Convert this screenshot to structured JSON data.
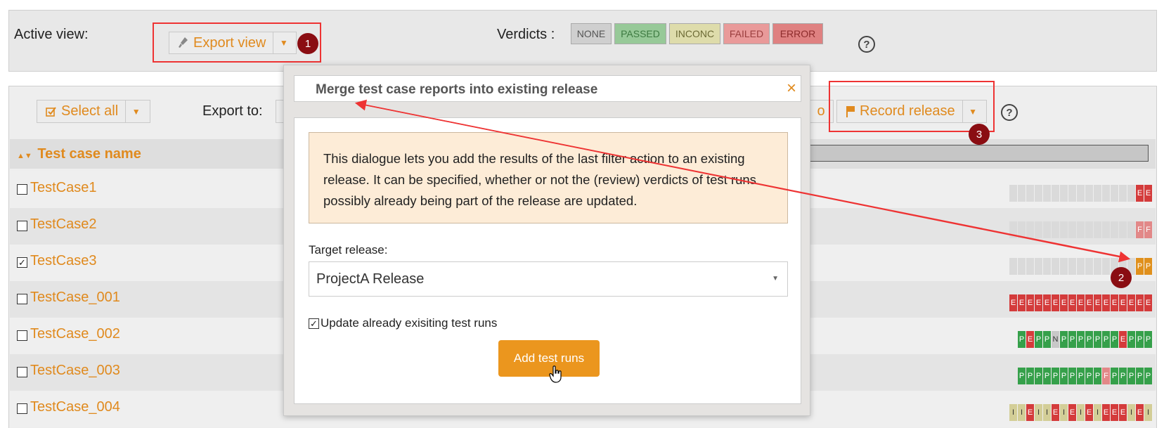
{
  "top": {
    "active_view_label": "Active view:",
    "export_view_label": "Export view",
    "verdicts_label": "Verdicts :",
    "verdicts": [
      {
        "label": "NONE",
        "bg": "#cfcfcf",
        "fg": "#555555"
      },
      {
        "label": "PASSED",
        "bg": "#97c998",
        "fg": "#3d7a41"
      },
      {
        "label": "INCONC",
        "bg": "#dedcab",
        "fg": "#6c6a35"
      },
      {
        "label": "FAILED",
        "bg": "#e99a9a",
        "fg": "#9b3f3f"
      },
      {
        "label": "ERROR",
        "bg": "#df8181",
        "fg": "#8d2c2c"
      }
    ],
    "help_glyph": "?"
  },
  "toolbar": {
    "select_all_label": "Select all",
    "export_to_label": "Export to:",
    "hidden_fragment": "o",
    "record_release_label": "Record release",
    "help_glyph": "?"
  },
  "table": {
    "column_header": "Test case name",
    "rows": [
      {
        "name": "TestCase1",
        "checked": false,
        "runs": [
          "",
          "",
          "",
          "",
          "",
          "",
          "",
          "",
          "",
          "",
          "",
          "",
          "",
          "",
          "",
          "E",
          "E"
        ],
        "kind": [
          "empty",
          "empty",
          "empty",
          "empty",
          "empty",
          "empty",
          "empty",
          "empty",
          "empty",
          "empty",
          "empty",
          "empty",
          "empty",
          "empty",
          "empty",
          "E",
          "E"
        ]
      },
      {
        "name": "TestCase2",
        "checked": false,
        "runs": [
          "",
          "",
          "",
          "",
          "",
          "",
          "",
          "",
          "",
          "",
          "",
          "",
          "",
          "",
          "",
          "F",
          "F"
        ],
        "kind": [
          "empty",
          "empty",
          "empty",
          "empty",
          "empty",
          "empty",
          "empty",
          "empty",
          "empty",
          "empty",
          "empty",
          "empty",
          "empty",
          "empty",
          "empty",
          "F",
          "F"
        ]
      },
      {
        "name": "TestCase3",
        "checked": true,
        "runs": [
          "",
          "",
          "",
          "",
          "",
          "",
          "",
          "",
          "",
          "",
          "",
          "",
          "",
          "",
          "",
          "P",
          "P"
        ],
        "kind": [
          "empty",
          "empty",
          "empty",
          "empty",
          "empty",
          "empty",
          "empty",
          "empty",
          "empty",
          "empty",
          "empty",
          "empty",
          "empty",
          "empty",
          "empty",
          "P",
          "P"
        ]
      },
      {
        "name": "TestCase_001",
        "checked": false,
        "runs": [
          "E",
          "E",
          "E",
          "E",
          "E",
          "E",
          "E",
          "E",
          "E",
          "E",
          "E",
          "E",
          "E",
          "E",
          "E",
          "E",
          "E"
        ],
        "kind": [
          "E",
          "E",
          "E",
          "E",
          "E",
          "E",
          "E",
          "E",
          "E",
          "E",
          "E",
          "E",
          "E",
          "E",
          "E",
          "E",
          "E"
        ]
      },
      {
        "name": "TestCase_002",
        "checked": false,
        "runs": [
          "P",
          "E",
          "P",
          "P",
          "N",
          "P",
          "P",
          "P",
          "P",
          "P",
          "P",
          "P",
          "E",
          "P",
          "P",
          "P"
        ],
        "kind": [
          "Pg",
          "E",
          "Pg",
          "Pg",
          "N",
          "Pg",
          "Pg",
          "Pg",
          "Pg",
          "Pg",
          "Pg",
          "Pg",
          "E",
          "Pg",
          "Pg",
          "Pg"
        ]
      },
      {
        "name": "TestCase_003",
        "checked": false,
        "runs": [
          "P",
          "P",
          "P",
          "P",
          "P",
          "P",
          "P",
          "P",
          "P",
          "P",
          "F",
          "P",
          "P",
          "P",
          "P",
          "P"
        ],
        "kind": [
          "Pg",
          "Pg",
          "Pg",
          "Pg",
          "Pg",
          "Pg",
          "Pg",
          "Pg",
          "Pg",
          "Pg",
          "F",
          "Pg",
          "Pg",
          "Pg",
          "Pg",
          "Pg"
        ]
      },
      {
        "name": "TestCase_004",
        "checked": false,
        "runs": [
          "I",
          "I",
          "E",
          "I",
          "I",
          "E",
          "I",
          "E",
          "I",
          "E",
          "I",
          "E",
          "E",
          "E",
          "I",
          "E",
          "I"
        ],
        "kind": [
          "I",
          "I",
          "E",
          "I",
          "I",
          "E",
          "I",
          "E",
          "I",
          "E",
          "I",
          "E",
          "E",
          "E",
          "I",
          "E",
          "I"
        ]
      }
    ]
  },
  "dialog": {
    "title": "Merge test case reports into existing release",
    "close_glyph": "×",
    "info_text": "This dialogue lets you add the results of the last filter action to an existing release. It can be specified, whether or not the (review) verdicts of test runs possibly already being part of the release are updated.",
    "target_label": "Target release:",
    "target_value": "ProjectA Release",
    "update_label": "Update already exisiting test runs",
    "add_button_label": "Add test runs"
  },
  "annotations": {
    "badge_1": "1",
    "badge_2": "2",
    "badge_3": "3"
  }
}
